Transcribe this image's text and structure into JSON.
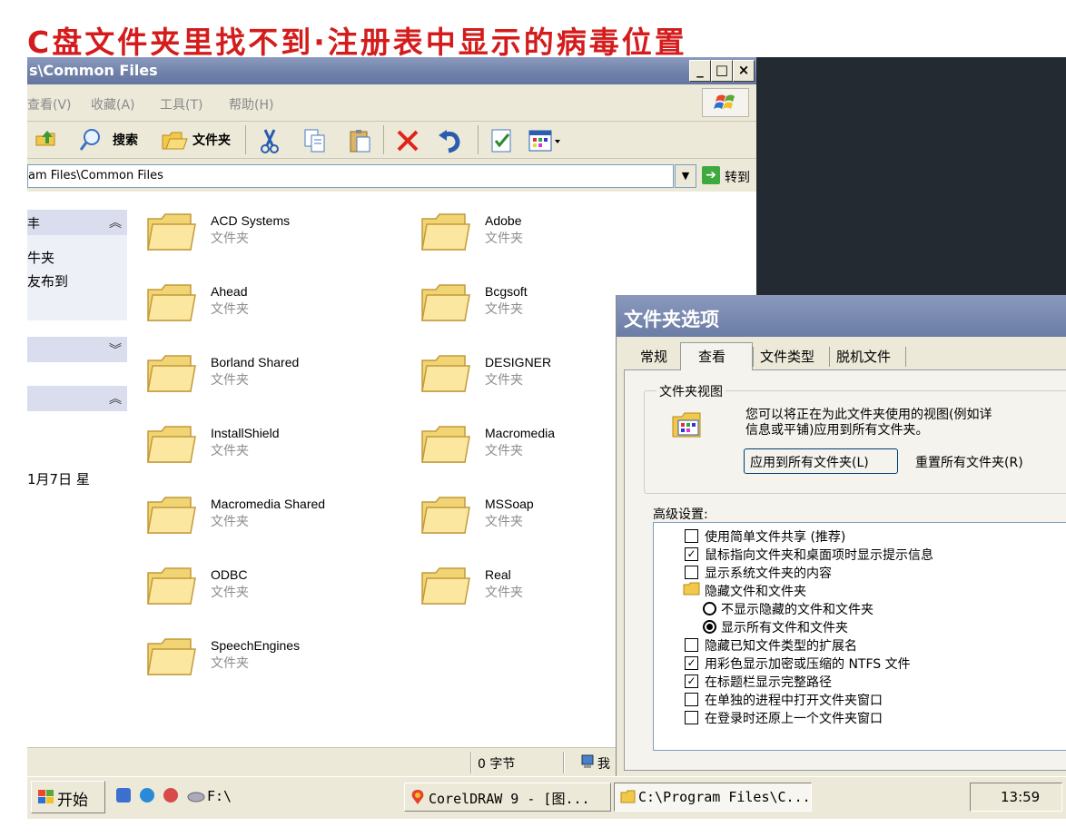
{
  "headline": "C盘文件夹里找不到·注册表中显示的病毒位置",
  "explorer": {
    "title": "s\\Common Files",
    "menu": [
      "查看(V)",
      "收藏(A)",
      "工具(T)",
      "帮助(H)"
    ],
    "toolbar": {
      "search_label": "搜索",
      "folders_label": "文件夹"
    },
    "address": "am Files\\Common Files",
    "go_label": "转到",
    "tasks": {
      "item1": "牛夹",
      "item2": "友布到",
      "detail_date": "1月7日 星"
    },
    "files": [
      {
        "name": "ACD Systems",
        "type": "文件夹"
      },
      {
        "name": "Adobe",
        "type": "文件夹"
      },
      {
        "name": "Ahead",
        "type": "文件夹"
      },
      {
        "name": "Bcgsoft",
        "type": "文件夹"
      },
      {
        "name": "Borland Shared",
        "type": "文件夹"
      },
      {
        "name": "DESIGNER",
        "type": "文件夹"
      },
      {
        "name": "InstallShield",
        "type": "文件夹"
      },
      {
        "name": "Macromedia",
        "type": "文件夹"
      },
      {
        "name": "Macromedia Shared",
        "type": "文件夹"
      },
      {
        "name": "MSSoap",
        "type": "文件夹"
      },
      {
        "name": "ODBC",
        "type": "文件夹"
      },
      {
        "name": "Real",
        "type": "文件夹"
      },
      {
        "name": "SpeechEngines",
        "type": "文件夹"
      }
    ],
    "status": {
      "size": "0 字节",
      "computer": "我"
    }
  },
  "dialog": {
    "title": "文件夹选项",
    "tabs": [
      "常规",
      "查看",
      "文件类型",
      "脱机文件"
    ],
    "group_label": "文件夹视图",
    "group_text_1": "您可以将正在为此文件夹使用的视图(例如详",
    "group_text_2": "信息或平铺)应用到所有文件夹。",
    "apply_all": "应用到所有文件夹(L)",
    "reset_all": "重置所有文件夹(R)",
    "advanced_label": "高级设置:",
    "advanced": [
      {
        "kind": "check",
        "checked": false,
        "text": "使用简单文件共享 (推荐)"
      },
      {
        "kind": "check",
        "checked": true,
        "text": "鼠标指向文件夹和桌面项时显示提示信息"
      },
      {
        "kind": "check",
        "checked": false,
        "text": "显示系统文件夹的内容"
      },
      {
        "kind": "folder",
        "text": "隐藏文件和文件夹"
      },
      {
        "kind": "radio",
        "checked": false,
        "text": "不显示隐藏的文件和文件夹"
      },
      {
        "kind": "radio",
        "checked": true,
        "text": "显示所有文件和文件夹"
      },
      {
        "kind": "check",
        "checked": false,
        "text": "隐藏已知文件类型的扩展名"
      },
      {
        "kind": "check",
        "checked": true,
        "text": "用彩色显示加密或压缩的 NTFS 文件"
      },
      {
        "kind": "check",
        "checked": true,
        "text": "在标题栏显示完整路径"
      },
      {
        "kind": "check",
        "checked": false,
        "text": "在单独的进程中打开文件夹窗口"
      },
      {
        "kind": "check",
        "checked": false,
        "text": "在登录时还原上一个文件夹窗口"
      }
    ]
  },
  "taskbar": {
    "start": "开始",
    "drive": "F:\\",
    "corel": "CorelDRAW 9 - [图...",
    "explorer": "C:\\Program Files\\C...",
    "clock": "13:59"
  }
}
